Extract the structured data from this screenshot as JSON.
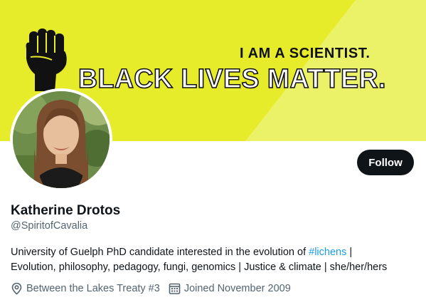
{
  "banner": {
    "line1": "I AM A SCIENTIST.",
    "line2": "BLACK LIVES MATTER.",
    "bg_color": "#e6ec29",
    "stripe_color": "#ecf267"
  },
  "profile": {
    "name": "Katherine Drotos",
    "handle": "@SpiritofCavalia",
    "follow_label": "Follow",
    "bio": {
      "line1_before": "University of Guelph PhD candidate interested in the evolution of ",
      "hashtag": "#lichens",
      "line1_after": " |",
      "line2": "Evolution, philosophy, pedagogy, fungi, genomics | Justice & climate | she/her/hers"
    },
    "location": "Between the Lakes Treaty #3",
    "joined": "Joined November 2009"
  },
  "icons": {
    "fist": "raised-fist-icon",
    "location": "location-pin-icon",
    "calendar": "calendar-icon"
  },
  "colors": {
    "text_primary": "#0f1419",
    "text_secondary": "#536471",
    "link": "#1d9bf0",
    "button_bg": "#0f1419"
  }
}
